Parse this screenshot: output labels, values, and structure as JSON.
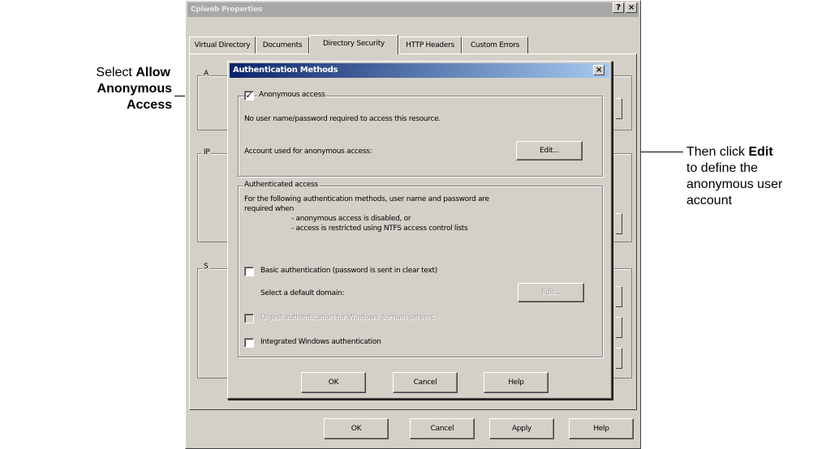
{
  "callouts": {
    "left_line1_prefix": "Select ",
    "left_line1_bold": "Allow",
    "left_line2_bold": "Anonymous Access",
    "right_line1_prefix": "Then click ",
    "right_line1_bold": "Edit",
    "right_line2": "to define the",
    "right_line3": "anonymous user",
    "right_line4": "account"
  },
  "outer_window": {
    "title": "Cpiweb Properties",
    "help_glyph": "?",
    "close_glyph": "×",
    "tabs": [
      "Virtual Directory",
      "Documents",
      "Directory Security",
      "HTTP Headers",
      "Custom Errors"
    ],
    "active_tab_index": 2,
    "ghost_labels": [
      "A",
      "IP",
      "S"
    ],
    "buttons": {
      "ok": "OK",
      "cancel": "Cancel",
      "apply": "Apply",
      "help": "Help"
    }
  },
  "dialog": {
    "title": "Authentication Methods",
    "close_glyph": "×",
    "anonymous": {
      "checked": true,
      "check_glyph": "✓",
      "label": "Anonymous access",
      "description": "No user name/password required to access this resource.",
      "account_label": "Account used for anonymous access:",
      "edit_label": "Edit..."
    },
    "authenticated": {
      "group_label": "Authenticated access",
      "desc_line1": "For the following authentication methods, user name and password are",
      "desc_line2": "required when",
      "bullet1": "- anonymous access is disabled, or",
      "bullet2": "- access is restricted using NTFS access control lists",
      "basic_label": "Basic authentication (password is sent in clear text)",
      "domain_label": "Select a default domain:",
      "domain_edit_label": "Edit...",
      "digest_label": "Digest authentication for Windows domain servers",
      "integrated_label": "Integrated Windows authentication"
    },
    "buttons": {
      "ok": "OK",
      "cancel": "Cancel",
      "help": "Help"
    }
  }
}
